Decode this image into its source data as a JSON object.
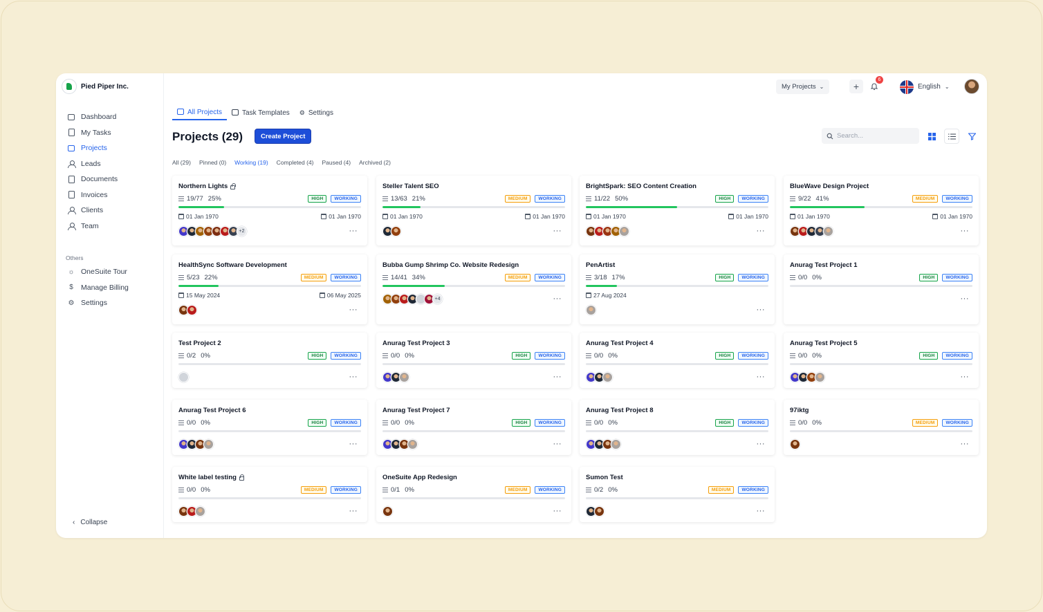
{
  "brand": {
    "name": "Pied Piper Inc."
  },
  "sidebar": {
    "items": [
      {
        "label": "Dashboard",
        "icon": "dashboard-icon",
        "active": false
      },
      {
        "label": "My Tasks",
        "icon": "tasks-icon",
        "active": false
      },
      {
        "label": "Projects",
        "icon": "projects-icon",
        "active": true
      },
      {
        "label": "Leads",
        "icon": "leads-icon",
        "active": false
      },
      {
        "label": "Documents",
        "icon": "documents-icon",
        "active": false
      },
      {
        "label": "Invoices",
        "icon": "invoices-icon",
        "active": false
      },
      {
        "label": "Clients",
        "icon": "clients-icon",
        "active": false
      },
      {
        "label": "Team",
        "icon": "team-icon",
        "active": false
      }
    ],
    "others_label": "Others",
    "others": [
      {
        "label": "OneSuite Tour",
        "icon": "sun-icon"
      },
      {
        "label": "Manage Billing",
        "icon": "dollar-icon"
      },
      {
        "label": "Settings",
        "icon": "gear-icon"
      }
    ],
    "collapse_label": "Collapse"
  },
  "topbar": {
    "my_projects": "My Projects",
    "notification_count": "6",
    "language": "English"
  },
  "tabs": [
    {
      "label": "All Projects",
      "active": true
    },
    {
      "label": "Task Templates",
      "active": false
    },
    {
      "label": "Settings",
      "active": false
    }
  ],
  "header": {
    "title": "Projects (29)",
    "create_button": "Create Project",
    "search_placeholder": "Search..."
  },
  "filters": [
    {
      "label": "All (29)",
      "active": false
    },
    {
      "label": "Pinned (0)",
      "active": false
    },
    {
      "label": "Working (19)",
      "active": true
    },
    {
      "label": "Completed (4)",
      "active": false
    },
    {
      "label": "Paused (4)",
      "active": false
    },
    {
      "label": "Archived (2)",
      "active": false
    }
  ],
  "colors": {
    "accent": "#2563eb",
    "progress": "#22c55e",
    "high": "#16a34a",
    "medium": "#f59e0b",
    "working": "#3b82f6"
  },
  "projects": [
    {
      "name": "Northern Lights",
      "locked": true,
      "tasks": "19/77",
      "percent": "25%",
      "progress": 25,
      "priority": "HIGH",
      "status": "WORKING",
      "start": "01 Jan 1970",
      "end": "01 Jan 1970",
      "avatar_colors": [
        "#4338ca",
        "#1f2937",
        "#a16207",
        "#92400e",
        "#7c2d12",
        "#b91c1c",
        "#374151"
      ],
      "extra": "+2"
    },
    {
      "name": "Steller Talent SEO",
      "locked": false,
      "tasks": "13/63",
      "percent": "21%",
      "progress": 21,
      "priority": "MEDIUM",
      "status": "WORKING",
      "start": "01 Jan 1970",
      "end": "01 Jan 1970",
      "avatar_colors": [
        "#1f2937",
        "#92400e"
      ],
      "extra": ""
    },
    {
      "name": "BrightSpark: SEO Content Creation",
      "locked": false,
      "tasks": "11/22",
      "percent": "50%",
      "progress": 50,
      "priority": "HIGH",
      "status": "WORKING",
      "start": "01 Jan 1970",
      "end": "01 Jan 1970",
      "avatar_colors": [
        "#78350f",
        "#b91c1c",
        "#9a3412",
        "#a16207",
        "#a8a29e"
      ],
      "extra": ""
    },
    {
      "name": "BlueWave Design Project",
      "locked": false,
      "tasks": "9/22",
      "percent": "41%",
      "progress": 41,
      "priority": "MEDIUM",
      "status": "WORKING",
      "start": "01 Jan 1970",
      "end": "01 Jan 1970",
      "avatar_colors": [
        "#78350f",
        "#b91c1c",
        "#1f2937",
        "#374151",
        "#a8a29e"
      ],
      "extra": ""
    },
    {
      "name": "HealthSync Software Development",
      "locked": false,
      "tasks": "5/23",
      "percent": "22%",
      "progress": 22,
      "priority": "MEDIUM",
      "status": "WORKING",
      "start": "15 May 2024",
      "end": "06 May 2025",
      "avatar_colors": [
        "#78350f",
        "#b91c1c"
      ],
      "extra": ""
    },
    {
      "name": "Bubba Gump Shrimp Co. Website Redesign",
      "locked": false,
      "tasks": "14/41",
      "percent": "34%",
      "progress": 34,
      "priority": "MEDIUM",
      "status": "WORKING",
      "start": "",
      "end": "",
      "avatar_colors": [
        "#a16207",
        "#92400e",
        "#b91c1c",
        "#1f2937",
        "#d1d5db",
        "#9f1239"
      ],
      "extra": "+4"
    },
    {
      "name": "PenArtist",
      "locked": false,
      "tasks": "3/18",
      "percent": "17%",
      "progress": 17,
      "priority": "HIGH",
      "status": "WORKING",
      "start": "27 Aug 2024",
      "end": "",
      "avatar_colors": [
        "#a8a29e"
      ],
      "extra": ""
    },
    {
      "name": "Anurag Test Project 1",
      "locked": false,
      "tasks": "0/0",
      "percent": "0%",
      "progress": 0,
      "priority": "HIGH",
      "status": "WORKING",
      "start": "",
      "end": "",
      "avatar_colors": [],
      "extra": ""
    },
    {
      "name": "Test Project 2",
      "locked": false,
      "tasks": "0/2",
      "percent": "0%",
      "progress": 0,
      "priority": "HIGH",
      "status": "WORKING",
      "start": "",
      "end": "",
      "avatar_colors": [
        "#d1d5db"
      ],
      "extra": ""
    },
    {
      "name": "Anurag Test Project 3",
      "locked": false,
      "tasks": "0/0",
      "percent": "0%",
      "progress": 0,
      "priority": "HIGH",
      "status": "WORKING",
      "start": "",
      "end": "",
      "avatar_colors": [
        "#4338ca",
        "#1f2937",
        "#a8a29e"
      ],
      "extra": ""
    },
    {
      "name": "Anurag Test Project 4",
      "locked": false,
      "tasks": "0/0",
      "percent": "0%",
      "progress": 0,
      "priority": "HIGH",
      "status": "WORKING",
      "start": "",
      "end": "",
      "avatar_colors": [
        "#4338ca",
        "#1f2937",
        "#a8a29e"
      ],
      "extra": ""
    },
    {
      "name": "Anurag Test Project 5",
      "locked": false,
      "tasks": "0/0",
      "percent": "0%",
      "progress": 0,
      "priority": "HIGH",
      "status": "WORKING",
      "start": "",
      "end": "",
      "avatar_colors": [
        "#4338ca",
        "#1f2937",
        "#92400e",
        "#a8a29e"
      ],
      "extra": ""
    },
    {
      "name": "Anurag Test Project 6",
      "locked": false,
      "tasks": "0/0",
      "percent": "0%",
      "progress": 0,
      "priority": "HIGH",
      "status": "WORKING",
      "start": "",
      "end": "",
      "avatar_colors": [
        "#4338ca",
        "#1f2937",
        "#78350f",
        "#a8a29e"
      ],
      "extra": ""
    },
    {
      "name": "Anurag Test Project 7",
      "locked": false,
      "tasks": "0/0",
      "percent": "0%",
      "progress": 0,
      "priority": "HIGH",
      "status": "WORKING",
      "start": "",
      "end": "",
      "avatar_colors": [
        "#4338ca",
        "#1f2937",
        "#78350f",
        "#a8a29e"
      ],
      "extra": ""
    },
    {
      "name": "Anurag Test Project 8",
      "locked": false,
      "tasks": "0/0",
      "percent": "0%",
      "progress": 0,
      "priority": "HIGH",
      "status": "WORKING",
      "start": "",
      "end": "",
      "avatar_colors": [
        "#4338ca",
        "#1f2937",
        "#78350f",
        "#a8a29e"
      ],
      "extra": ""
    },
    {
      "name": "97iktg",
      "locked": false,
      "tasks": "0/0",
      "percent": "0%",
      "progress": 0,
      "priority": "MEDIUM",
      "status": "WORKING",
      "start": "",
      "end": "",
      "avatar_colors": [
        "#78350f"
      ],
      "extra": ""
    },
    {
      "name": "White label testing",
      "locked": true,
      "tasks": "0/0",
      "percent": "0%",
      "progress": 0,
      "priority": "MEDIUM",
      "status": "WORKING",
      "start": "",
      "end": "",
      "avatar_colors": [
        "#78350f",
        "#b91c1c",
        "#a8a29e"
      ],
      "extra": ""
    },
    {
      "name": "OneSuite App Redesign",
      "locked": false,
      "tasks": "0/1",
      "percent": "0%",
      "progress": 0,
      "priority": "MEDIUM",
      "status": "WORKING",
      "start": "",
      "end": "",
      "avatar_colors": [
        "#78350f"
      ],
      "extra": ""
    },
    {
      "name": "Sumon Test",
      "locked": false,
      "tasks": "0/2",
      "percent": "0%",
      "progress": 0,
      "priority": "MEDIUM",
      "status": "WORKING",
      "start": "",
      "end": "",
      "avatar_colors": [
        "#1f2937",
        "#78350f"
      ],
      "extra": ""
    }
  ]
}
